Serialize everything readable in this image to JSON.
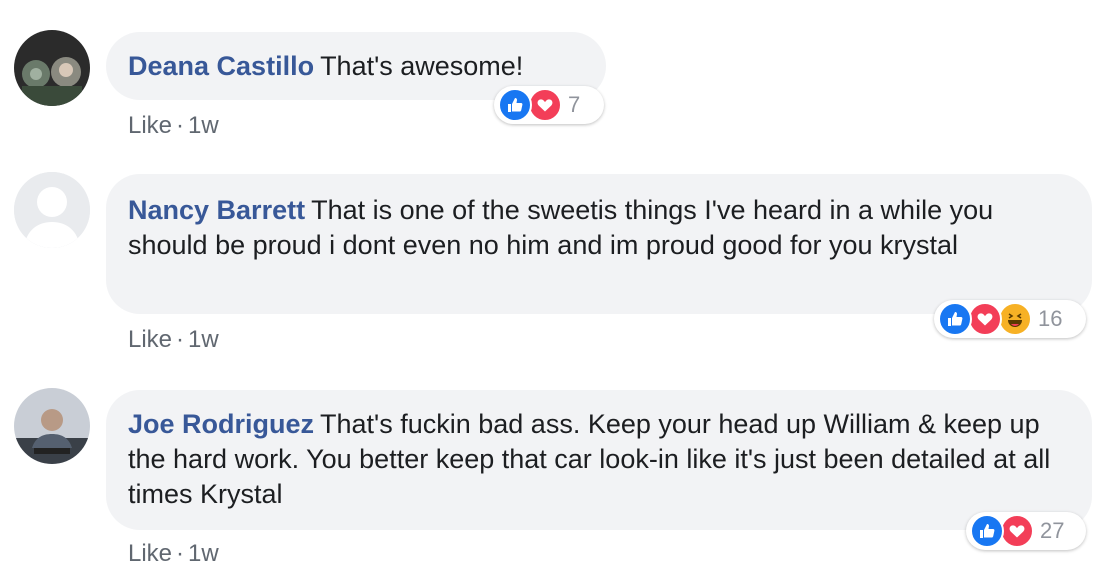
{
  "comments": [
    {
      "author": "Deana Castillo",
      "text": "That's awesome!",
      "like_label": "Like",
      "separator": "·",
      "time": "1w",
      "reaction_icons": [
        "like-icon",
        "love-icon"
      ],
      "reaction_count": "7"
    },
    {
      "author": "Nancy Barrett",
      "text": "That is one of the sweetis things I've heard in a while you should be proud i dont even no him and im proud good for you krystal",
      "like_label": "Like",
      "separator": "·",
      "time": "1w",
      "reaction_icons": [
        "like-icon",
        "love-icon",
        "haha-icon"
      ],
      "reaction_count": "16"
    },
    {
      "author": "Joe Rodriguez",
      "text": "That's fuckin bad ass. Keep your head up William & keep up the hard work. You better keep that car look-in like it's just been detailed at all times Krystal",
      "like_label": "Like",
      "separator": "·",
      "time": "1w",
      "reaction_icons": [
        "like-icon",
        "love-icon"
      ],
      "reaction_count": "27"
    }
  ],
  "colors": {
    "author": "#385898",
    "bubble": "#f2f3f5",
    "meta": "#606770",
    "like_reaction": "#1877f2",
    "love_reaction": "#f33e58",
    "haha_reaction": "#f7b125"
  }
}
